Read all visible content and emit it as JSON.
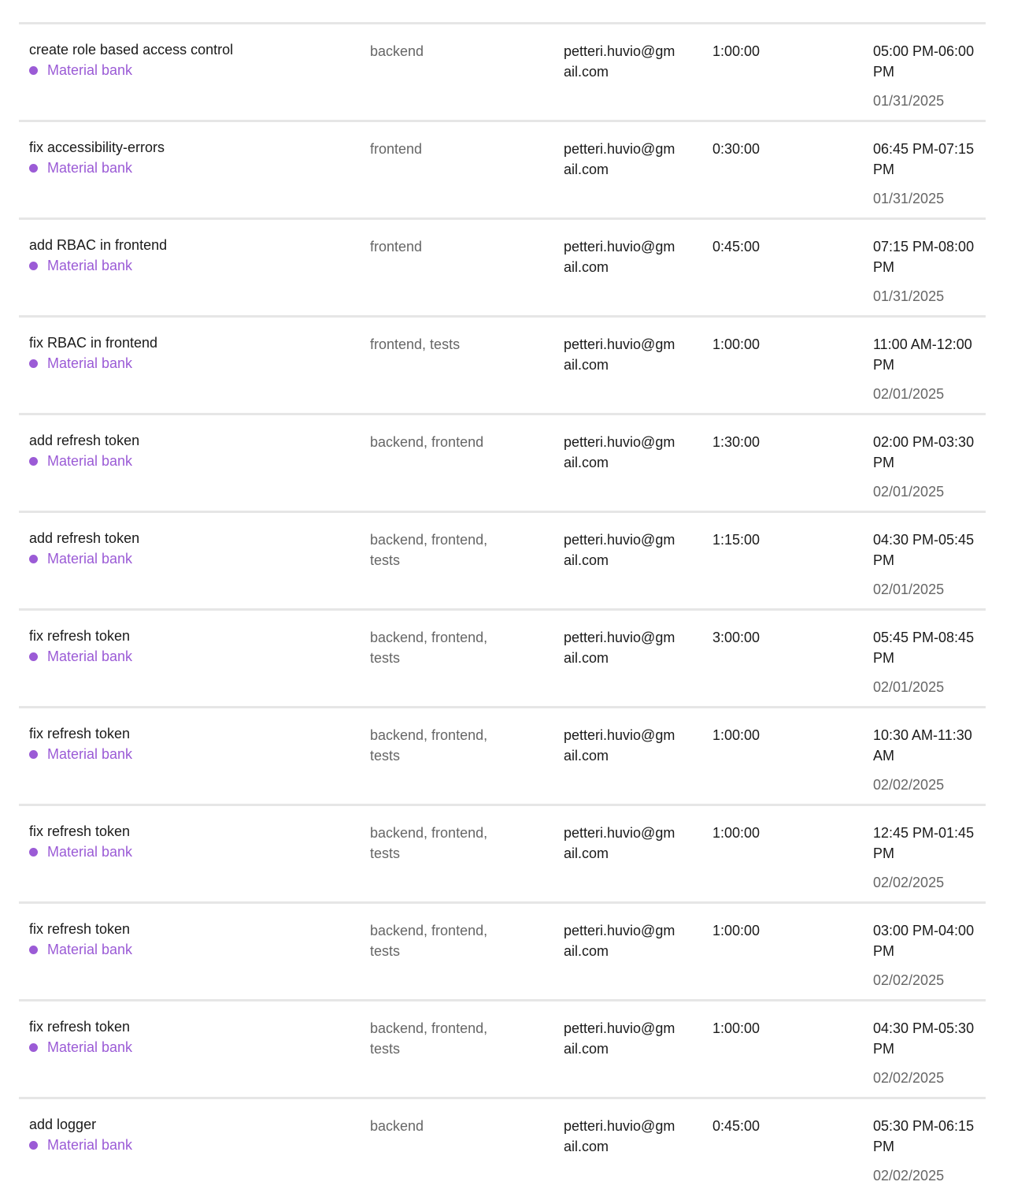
{
  "colors": {
    "project": "#9b5bd6",
    "separator": "#e6e6e6"
  },
  "entries": [
    {
      "title": "create role based access control",
      "project": "Material bank",
      "tags": "backend",
      "user": "petteri.huvio@gmail.com",
      "duration": "1:00:00",
      "time": "05:00 PM-06:00 PM",
      "date": "01/31/2025"
    },
    {
      "title": "fix accessibility-errors",
      "project": "Material bank",
      "tags": "frontend",
      "user": "petteri.huvio@gmail.com",
      "duration": "0:30:00",
      "time": "06:45 PM-07:15 PM",
      "date": "01/31/2025"
    },
    {
      "title": "add RBAC in frontend",
      "project": "Material bank",
      "tags": "frontend",
      "user": "petteri.huvio@gmail.com",
      "duration": "0:45:00",
      "time": "07:15 PM-08:00 PM",
      "date": "01/31/2025"
    },
    {
      "title": "fix RBAC in frontend",
      "project": "Material bank",
      "tags": "frontend, tests",
      "user": "petteri.huvio@gmail.com",
      "duration": "1:00:00",
      "time": "11:00 AM-12:00 PM",
      "date": "02/01/2025"
    },
    {
      "title": "add refresh token",
      "project": "Material bank",
      "tags": "backend, frontend",
      "user": "petteri.huvio@gmail.com",
      "duration": "1:30:00",
      "time": "02:00 PM-03:30 PM",
      "date": "02/01/2025"
    },
    {
      "title": "add refresh token",
      "project": "Material bank",
      "tags": "backend, frontend, tests",
      "user": "petteri.huvio@gmail.com",
      "duration": "1:15:00",
      "time": "04:30 PM-05:45 PM",
      "date": "02/01/2025"
    },
    {
      "title": "fix refresh token",
      "project": "Material bank",
      "tags": "backend, frontend, tests",
      "user": "petteri.huvio@gmail.com",
      "duration": "3:00:00",
      "time": "05:45 PM-08:45 PM",
      "date": "02/01/2025"
    },
    {
      "title": "fix refresh token",
      "project": "Material bank",
      "tags": "backend, frontend, tests",
      "user": "petteri.huvio@gmail.com",
      "duration": "1:00:00",
      "time": "10:30 AM-11:30 AM",
      "date": "02/02/2025"
    },
    {
      "title": "fix refresh token",
      "project": "Material bank",
      "tags": "backend, frontend, tests",
      "user": "petteri.huvio@gmail.com",
      "duration": "1:00:00",
      "time": "12:45 PM-01:45 PM",
      "date": "02/02/2025"
    },
    {
      "title": "fix refresh token",
      "project": "Material bank",
      "tags": "backend, frontend, tests",
      "user": "petteri.huvio@gmail.com",
      "duration": "1:00:00",
      "time": "03:00 PM-04:00 PM",
      "date": "02/02/2025"
    },
    {
      "title": "fix refresh token",
      "project": "Material bank",
      "tags": "backend, frontend, tests",
      "user": "petteri.huvio@gmail.com",
      "duration": "1:00:00",
      "time": "04:30 PM-05:30 PM",
      "date": "02/02/2025"
    },
    {
      "title": "add logger",
      "project": "Material bank",
      "tags": "backend",
      "user": "petteri.huvio@gmail.com",
      "duration": "0:45:00",
      "time": "05:30 PM-06:15 PM",
      "date": "02/02/2025"
    }
  ]
}
